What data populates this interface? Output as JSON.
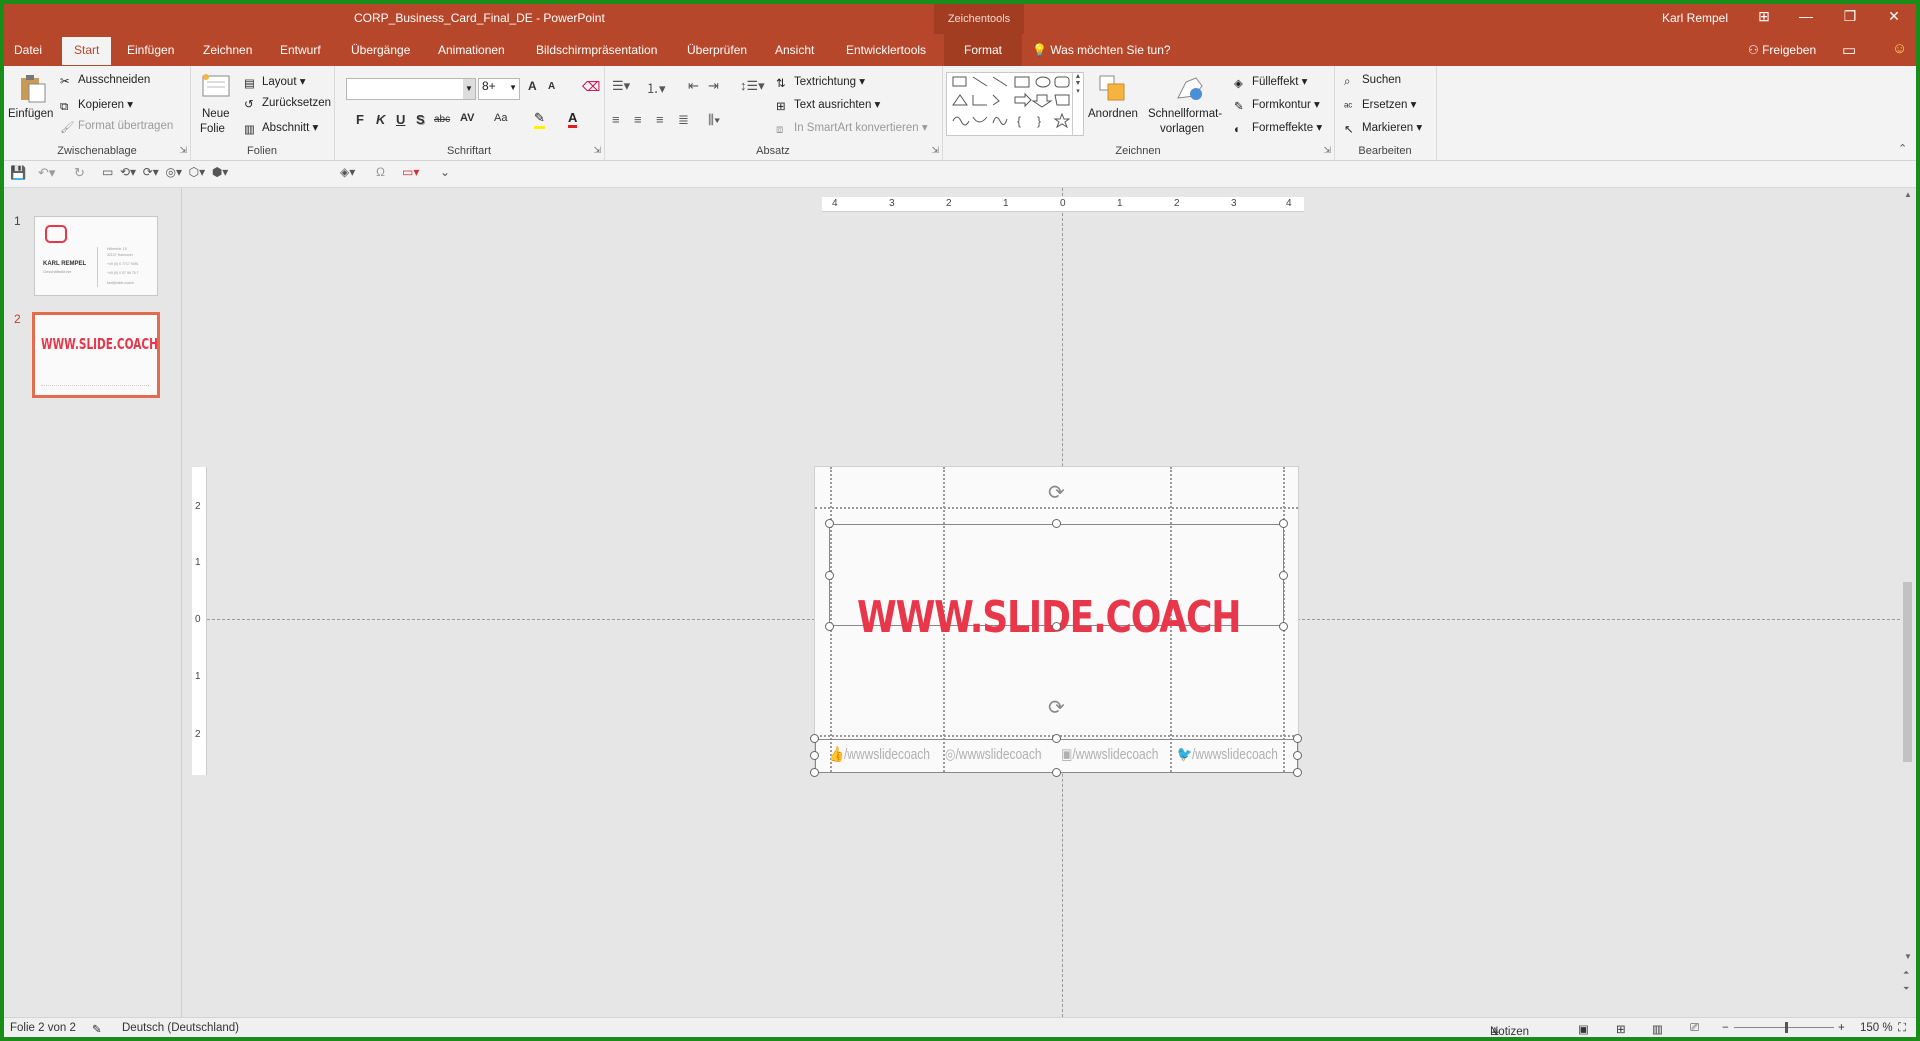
{
  "window": {
    "title": "CORP_Business_Card_Final_DE  -  PowerPoint",
    "contextual_group": "Zeichentools",
    "user": "Karl Rempel",
    "controls": [
      "⊞",
      "—",
      "❐",
      "✕"
    ]
  },
  "tabs": [
    "Datei",
    "Start",
    "Einfügen",
    "Zeichnen",
    "Entwurf",
    "Übergänge",
    "Animationen",
    "Bildschirmpräsentation",
    "Überprüfen",
    "Ansicht",
    "Entwicklertools",
    "Format"
  ],
  "active_tab": "Start",
  "tell_me": "Was möchten Sie tun?",
  "share": "Freigeben",
  "ribbon": {
    "clipboard": {
      "label": "Zwischenablage",
      "paste": "Einfügen",
      "cut": "Ausschneiden",
      "copy": "Kopieren",
      "format_painter": "Format übertragen"
    },
    "slides": {
      "label": "Folien",
      "new_slide_1": "Neue",
      "new_slide_2": "Folie",
      "layout": "Layout",
      "reset": "Zurücksetzen",
      "section": "Abschnitt"
    },
    "font": {
      "label": "Schriftart",
      "font_name": "",
      "font_size": "8+",
      "bold": "F",
      "italic": "K",
      "underline": "U",
      "shadow": "S",
      "strike": "abc",
      "spacing": "AV",
      "case": "Aa",
      "grow": "A",
      "shrink": "A"
    },
    "paragraph": {
      "label": "Absatz",
      "text_direction": "Textrichtung",
      "align_text": "Text ausrichten",
      "smartart": "In SmartArt konvertieren"
    },
    "drawing": {
      "label": "Zeichnen",
      "arrange": "Anordnen",
      "quick_styles_1": "Schnellformat-",
      "quick_styles_2": "vorlagen",
      "fill": "Fülleffekt",
      "outline": "Formkontur",
      "effects": "Formeffekte"
    },
    "editing": {
      "label": "Bearbeiten",
      "find": "Suchen",
      "replace": "Ersetzen",
      "select": "Markieren"
    }
  },
  "slides": [
    {
      "number": "1",
      "name": "KARL REMPEL",
      "subtitle": "Geschäftsführer",
      "lines": [
        "Hilbertstr. 15",
        "32107 Hannover",
        "+49 (0) 0 7717 9491",
        "+49 (0) 0 57 96 75 7",
        "karl@slide.coach"
      ]
    },
    {
      "number": "2",
      "headline": "WWW.SLIDE.COACH"
    }
  ],
  "current_slide": {
    "headline": "WWW.SLIDE.COACH",
    "social": [
      "/wwwslidecoach",
      "/wwwslidecoach",
      "/wwwslidecoach",
      "/wwwslidecoach"
    ],
    "social_icons": [
      "like-icon",
      "instagram-icon",
      "youtube-icon",
      "twitter-icon"
    ],
    "headline_color": "#e8364a"
  },
  "rulers": {
    "horizontal": [
      "4",
      "3",
      "2",
      "1",
      "0",
      "1",
      "2",
      "3",
      "4"
    ],
    "vertical": [
      "2",
      "1",
      "0",
      "1",
      "2"
    ]
  },
  "status": {
    "slide_info": "Folie 2 von 2",
    "language": "Deutsch (Deutschland)",
    "notes": "Notizen",
    "zoom": "150 %"
  },
  "colors": {
    "accent": "#b7472a",
    "frame": "#1a8c1a"
  }
}
